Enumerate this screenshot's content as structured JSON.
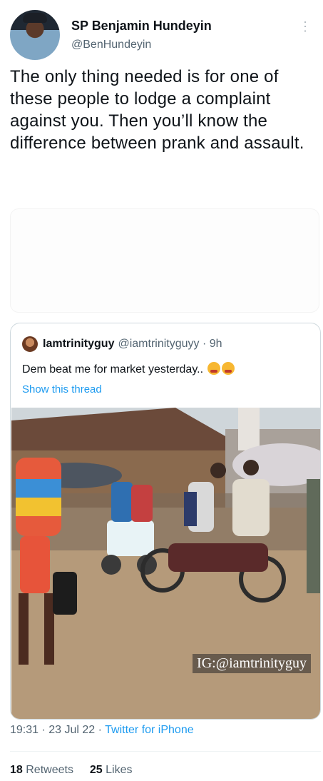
{
  "author": {
    "name": "SP Benjamin Hundeyin",
    "handle": "@BenHundeyin",
    "more_icon": "more-vertical-icon"
  },
  "tweet": {
    "text": "The only thing needed is for one of these people to lodge a complaint against you. Then you’ll know the difference between prank and assault."
  },
  "quoted_tweet": {
    "name": "Iamtrinityguy",
    "handle_time": "@iamtrinityguyy · 9h",
    "text": "Dem beat me for market yesterday..",
    "emoji": "angry-face-emoji",
    "link": "Show this thread",
    "image_watermark": "IG:@iamtrinityguy"
  },
  "meta": {
    "time_date": "19:31 · 23 Jul 22 · ",
    "source": "Twitter for iPhone"
  },
  "stats": {
    "retweets_count": "18",
    "retweets_label": "Retweets",
    "likes_count": "25",
    "likes_label": "Likes"
  },
  "colors": {
    "link": "#1d9bf0",
    "secondary_text": "#536471",
    "border": "#cfd9de"
  }
}
